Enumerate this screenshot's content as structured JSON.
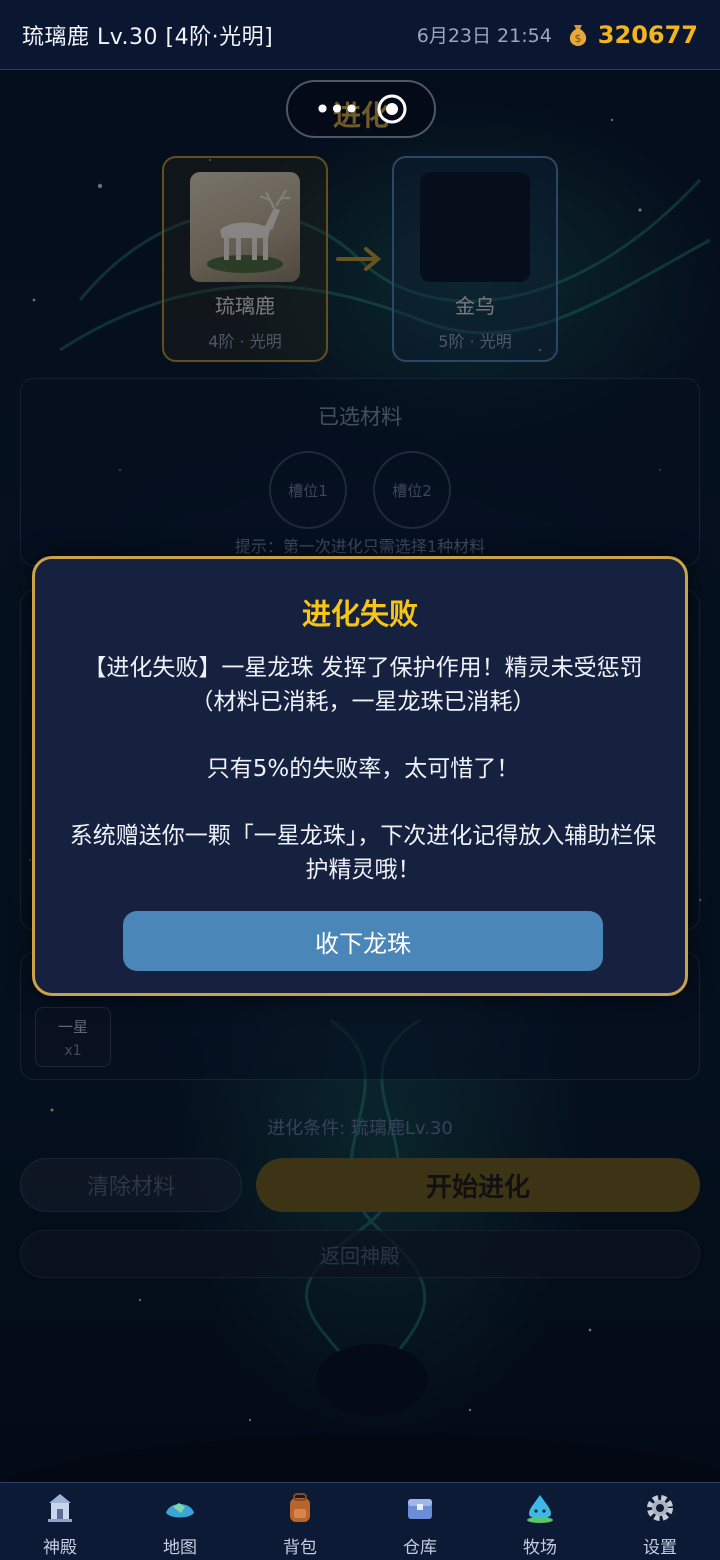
{
  "status": {
    "title": "琉璃鹿 Lv.30 [4阶·光明]",
    "datetime": "6月23日 21:54",
    "gold": "320677"
  },
  "page": {
    "title": "进化",
    "more_icon": "more-dots-icon",
    "target_icon": "target-icon"
  },
  "evolution": {
    "current": {
      "name": "琉璃鹿",
      "sub": "4阶 · 光明"
    },
    "next": {
      "name": "金乌",
      "sub": "5阶 · 光明"
    }
  },
  "materials": {
    "title": "已选材料",
    "slot1": "槽位1",
    "slot2": "槽位2",
    "hint": "提示：第一次进化只需选择1种材料"
  },
  "aux": {
    "item_name": "一星",
    "item_count": "x1"
  },
  "condition": "进化条件: 琉璃鹿Lv.30",
  "buttons": {
    "clear": "清除材料",
    "start": "开始进化",
    "back": "返回神殿"
  },
  "modal": {
    "title": "进化失败",
    "message1": "【进化失败】一星龙珠 发挥了保护作用！精灵未受惩罚（材料已消耗，一星龙珠已消耗）",
    "message2": "只有5%的失败率，太可惜了！",
    "message3": "系统赠送你一颗「一星龙珠」，下次进化记得放入辅助栏保护精灵哦！",
    "button": "收下龙珠"
  },
  "nav": [
    {
      "label": "神殿",
      "icon": "temple-icon"
    },
    {
      "label": "地图",
      "icon": "map-icon"
    },
    {
      "label": "背包",
      "icon": "backpack-icon"
    },
    {
      "label": "仓库",
      "icon": "warehouse-icon"
    },
    {
      "label": "牧场",
      "icon": "ranch-icon"
    },
    {
      "label": "设置",
      "icon": "gear-icon"
    }
  ],
  "colors": {
    "gold_text": "#f2b51f",
    "modal_title": "#f5c518",
    "modal_border": "#c9a24a",
    "modal_button": "#4a86b8",
    "start_button": "#6e5a1d"
  }
}
